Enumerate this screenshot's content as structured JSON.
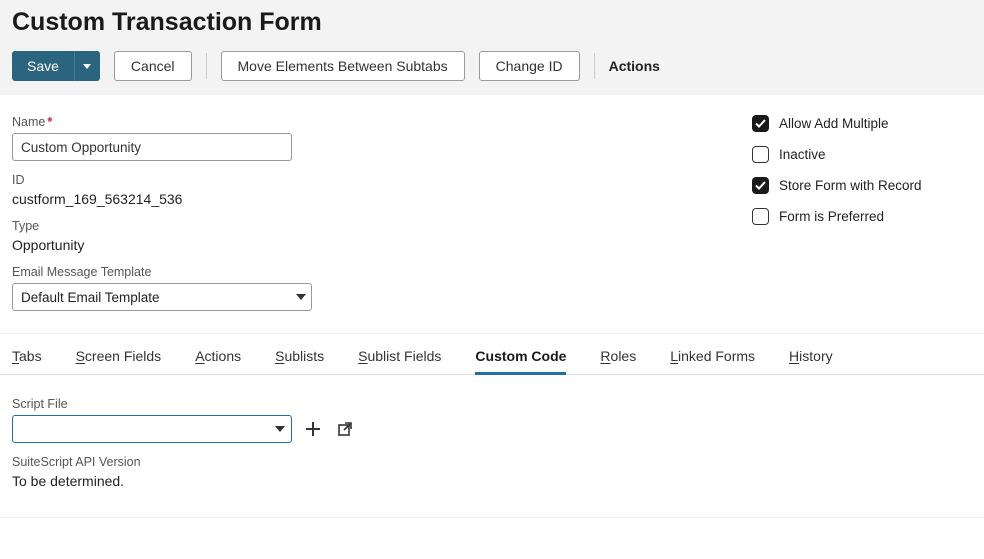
{
  "header": {
    "title": "Custom Transaction Form"
  },
  "toolbar": {
    "save": "Save",
    "cancel": "Cancel",
    "move_elements": "Move Elements Between Subtabs",
    "change_id": "Change ID",
    "actions": "Actions"
  },
  "fields": {
    "name_label": "Name",
    "name_value": "Custom Opportunity",
    "id_label": "ID",
    "id_value": "custform_169_563214_536",
    "type_label": "Type",
    "type_value": "Opportunity",
    "email_tpl_label": "Email Message Template",
    "email_tpl_value": "Default Email Template"
  },
  "checkboxes": {
    "allow_add_multiple": {
      "label": "Allow Add Multiple",
      "checked": true
    },
    "inactive": {
      "label": "Inactive",
      "checked": false
    },
    "store_form": {
      "label": "Store Form with Record",
      "checked": true
    },
    "preferred": {
      "label": "Form is Preferred",
      "checked": false
    }
  },
  "tabs": [
    {
      "label": "Tabs",
      "accesskey": "T"
    },
    {
      "label": "Screen Fields",
      "accesskey": "S"
    },
    {
      "label": "Actions",
      "accesskey": "A"
    },
    {
      "label": "Sublists",
      "accesskey": "S"
    },
    {
      "label": "Sublist Fields",
      "accesskey": "S"
    },
    {
      "label": "Custom Code",
      "accesskey": "",
      "active": true
    },
    {
      "label": "Roles",
      "accesskey": "R"
    },
    {
      "label": "Linked Forms",
      "accesskey": "L"
    },
    {
      "label": "History",
      "accesskey": "H"
    }
  ],
  "custom_code": {
    "script_file_label": "Script File",
    "script_file_value": "",
    "api_version_label": "SuiteScript API Version",
    "api_version_value": "To be determined."
  }
}
